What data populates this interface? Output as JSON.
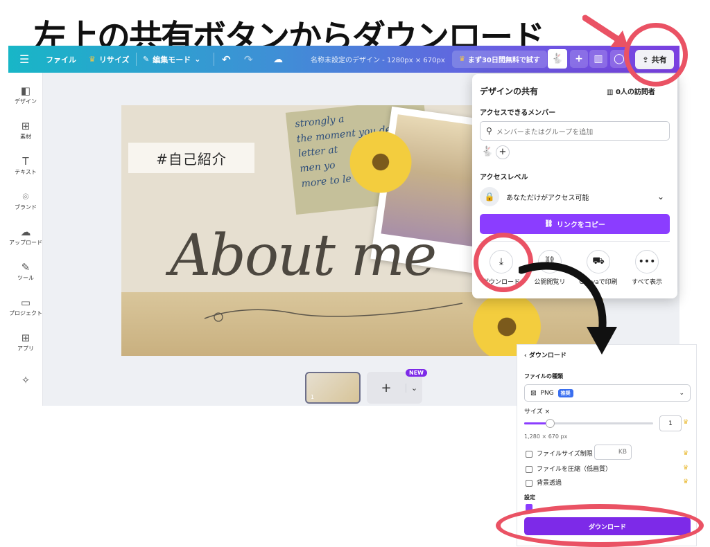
{
  "headline": "左上の共有ボタンからダウンロード",
  "topbar": {
    "menu_icon": "menu-icon",
    "file": "ファイル",
    "resize": "リサイズ",
    "edit_mode": "編集モード",
    "doc_title": "名称未設定のデザイン - 1280px × 670px",
    "trial": "まず30日間無料で試す",
    "share": "共有"
  },
  "sidebar": {
    "items": [
      {
        "label": "デザイン",
        "icon": "layout-icon"
      },
      {
        "label": "素材",
        "icon": "shapes-icon"
      },
      {
        "label": "テキスト",
        "icon": "text-icon"
      },
      {
        "label": "ブランド",
        "icon": "brand-icon"
      },
      {
        "label": "アップロード",
        "icon": "upload-icon"
      },
      {
        "label": "ツール",
        "icon": "pen-icon"
      },
      {
        "label": "プロジェクト",
        "icon": "folder-icon"
      },
      {
        "label": "アプリ",
        "icon": "apps-icon"
      }
    ]
  },
  "canvas": {
    "tag": "#自己紹介",
    "script_title": "About me",
    "paper_text": "strongly a\nthe moment you de\nletter at\nmen yo\nmore to le"
  },
  "pages": {
    "new_badge": "NEW",
    "add": "+",
    "thumb_page": "1"
  },
  "share_panel": {
    "title": "デザインの共有",
    "visitors": "0人の訪問者",
    "members_label": "アクセスできるメンバー",
    "search_placeholder": "メンバーまたはグループを追加",
    "access_label": "アクセスレベル",
    "access_value": "あなただけがアクセス可能",
    "copy_link": "リンクをコピー",
    "actions": [
      {
        "label": "ダウンロード",
        "icon": "download-icon"
      },
      {
        "label": "公開閲覧リ",
        "icon": "link-icon"
      },
      {
        "label": "Canvaで印刷",
        "icon": "truck-icon"
      },
      {
        "label": "すべて表示",
        "icon": "more-icon"
      }
    ]
  },
  "download_panel": {
    "back": "ダウンロード",
    "file_type_label": "ファイルの種類",
    "file_type": "PNG",
    "recommended": "推奨",
    "size_label": "サイズ ×",
    "size_value": "1",
    "size_fraction": 0.2,
    "dimensions": "1,280 × 670 px",
    "limit_size": "ファイルサイズ制限",
    "kb": "KB",
    "compress": "ファイルを圧縮（低画質）",
    "transparent": "背景透過",
    "settings": "設定",
    "download_button": "ダウンロード"
  },
  "colors": {
    "accent": "#8b3dff",
    "annotation": "#ea5264"
  }
}
